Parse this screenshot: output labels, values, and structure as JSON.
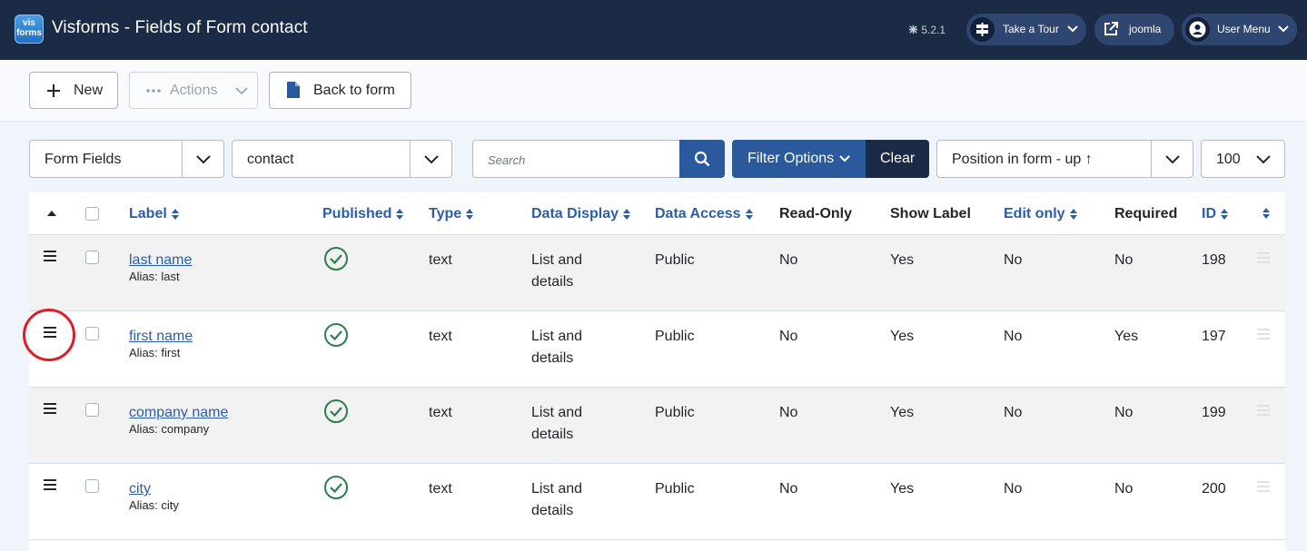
{
  "header": {
    "logo_text_top": "vis",
    "logo_text_bottom": "forms",
    "title": "Visforms - Fields of Form contact",
    "version": "5.2.1",
    "tour_label": "Take a Tour",
    "site_label": "joomla",
    "user_menu_label": "User Menu"
  },
  "toolbar": {
    "new_label": "New",
    "actions_label": "Actions",
    "back_label": "Back to form"
  },
  "filters": {
    "view_select": "Form Fields",
    "form_select": "contact",
    "search_placeholder": "Search",
    "filter_options_label": "Filter Options",
    "clear_label": "Clear",
    "ordering_select": "Position in form - up ↑",
    "limit_select": "100"
  },
  "table": {
    "headers": {
      "label": "Label",
      "published": "Published",
      "type": "Type",
      "data_display": "Data Display",
      "data_access": "Data Access",
      "read_only": "Read-Only",
      "show_label": "Show Label",
      "edit_only": "Edit only",
      "required": "Required",
      "id": "ID"
    },
    "rows": [
      {
        "label": "last name",
        "alias": "Alias: last",
        "type": "text",
        "display_1": "List and",
        "display_2": "details",
        "access": "Public",
        "read_only": "No",
        "show_label": "Yes",
        "edit_only": "No",
        "required": "No",
        "id": "198"
      },
      {
        "label": "first name",
        "alias": "Alias: first",
        "type": "text",
        "display_1": "List and",
        "display_2": "details",
        "access": "Public",
        "read_only": "No",
        "show_label": "Yes",
        "edit_only": "No",
        "required": "Yes",
        "id": "197"
      },
      {
        "label": "company name",
        "alias": "Alias: company",
        "type": "text",
        "display_1": "List and",
        "display_2": "details",
        "access": "Public",
        "read_only": "No",
        "show_label": "Yes",
        "edit_only": "No",
        "required": "No",
        "id": "199"
      },
      {
        "label": "city",
        "alias": "Alias: city",
        "type": "text",
        "display_1": "List and",
        "display_2": "details",
        "access": "Public",
        "read_only": "No",
        "show_label": "Yes",
        "edit_only": "No",
        "required": "No",
        "id": "200"
      }
    ]
  },
  "colors": {
    "header_bg": "#1c2b45",
    "link": "#2c5ea8",
    "primary_button": "#2a5a9c",
    "published_green": "#2e7d4f",
    "highlight_circle": "#d9202a"
  }
}
